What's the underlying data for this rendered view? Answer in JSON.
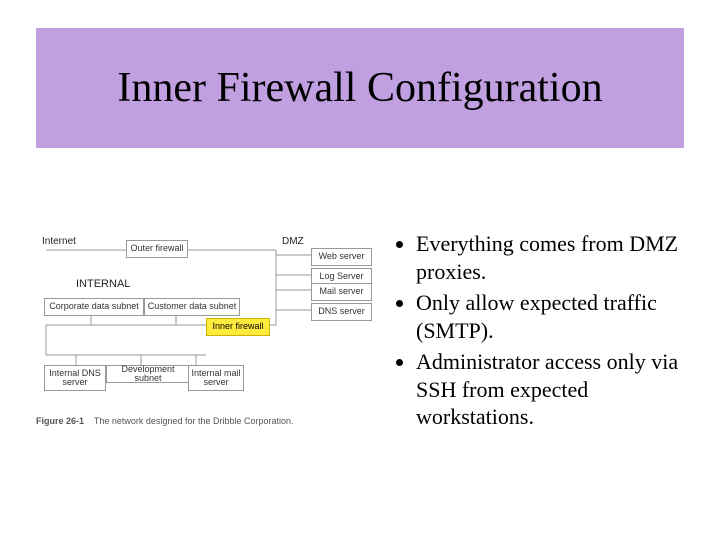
{
  "title": "Inner Firewall Configuration",
  "diagram": {
    "labels": {
      "internet": "Internet",
      "dmz": "DMZ",
      "internal": "INTERNAL"
    },
    "nodes": {
      "outer_fw": "Outer firewall",
      "web": "Web server",
      "log": "Log Server",
      "mail": "Mail server",
      "dns": "DNS server",
      "inner_fw": "Inner firewall",
      "corp": "Corporate data subnet",
      "cust": "Customer data subnet",
      "idns": "Internal DNS server",
      "dev": "Development subnet",
      "imail": "Internal mail server"
    },
    "caption_label": "Figure 26-1",
    "caption_text": "The network designed for the Dribble Corporation."
  },
  "bullets": [
    "Everything comes from DMZ proxies.",
    "Only allow expected traffic (SMTP).",
    "Administrator access only via SSH from expected workstations."
  ]
}
